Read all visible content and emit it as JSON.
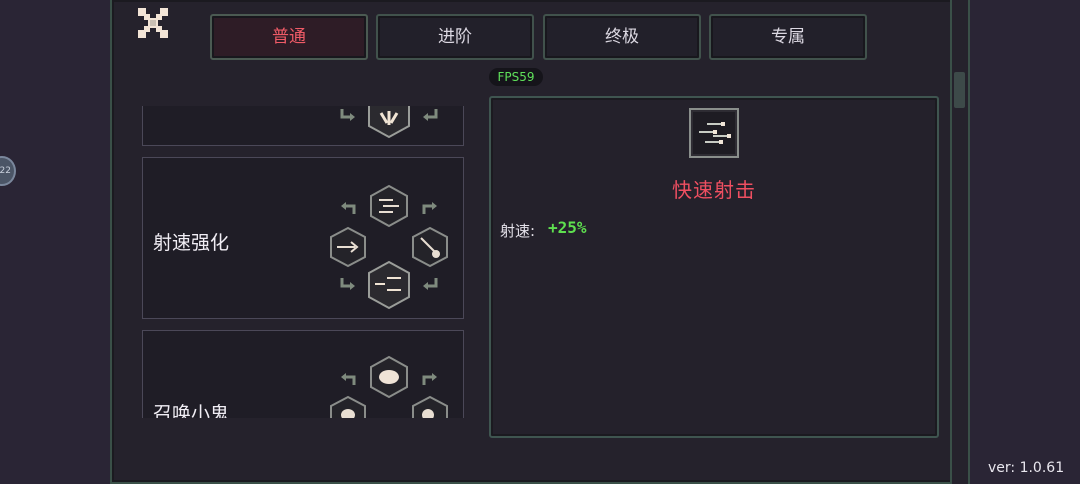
{
  "tabs": [
    {
      "label": "普通",
      "active": true
    },
    {
      "label": "进阶",
      "active": false
    },
    {
      "label": "终极",
      "active": false
    },
    {
      "label": "专属",
      "active": false
    }
  ],
  "fps": "FPS59",
  "skills": [
    {
      "label": "射速强化"
    },
    {
      "label": "召唤小鬼"
    }
  ],
  "detail": {
    "title": "快速射击",
    "stat_label": "射速:",
    "stat_value": "+25%"
  },
  "version": "ver: 1.0.61",
  "side_badge": "22",
  "colors": {
    "accent_red": "#ef4f61",
    "stat_green": "#5ee04f",
    "fps_green": "#5fe05a",
    "border": "#3a5048",
    "panel_bg": "#25222c"
  },
  "icons": {
    "close": "close-x-icon",
    "skill": "hexagon-skill-icon",
    "arrow": "corner-arrow-icon"
  }
}
